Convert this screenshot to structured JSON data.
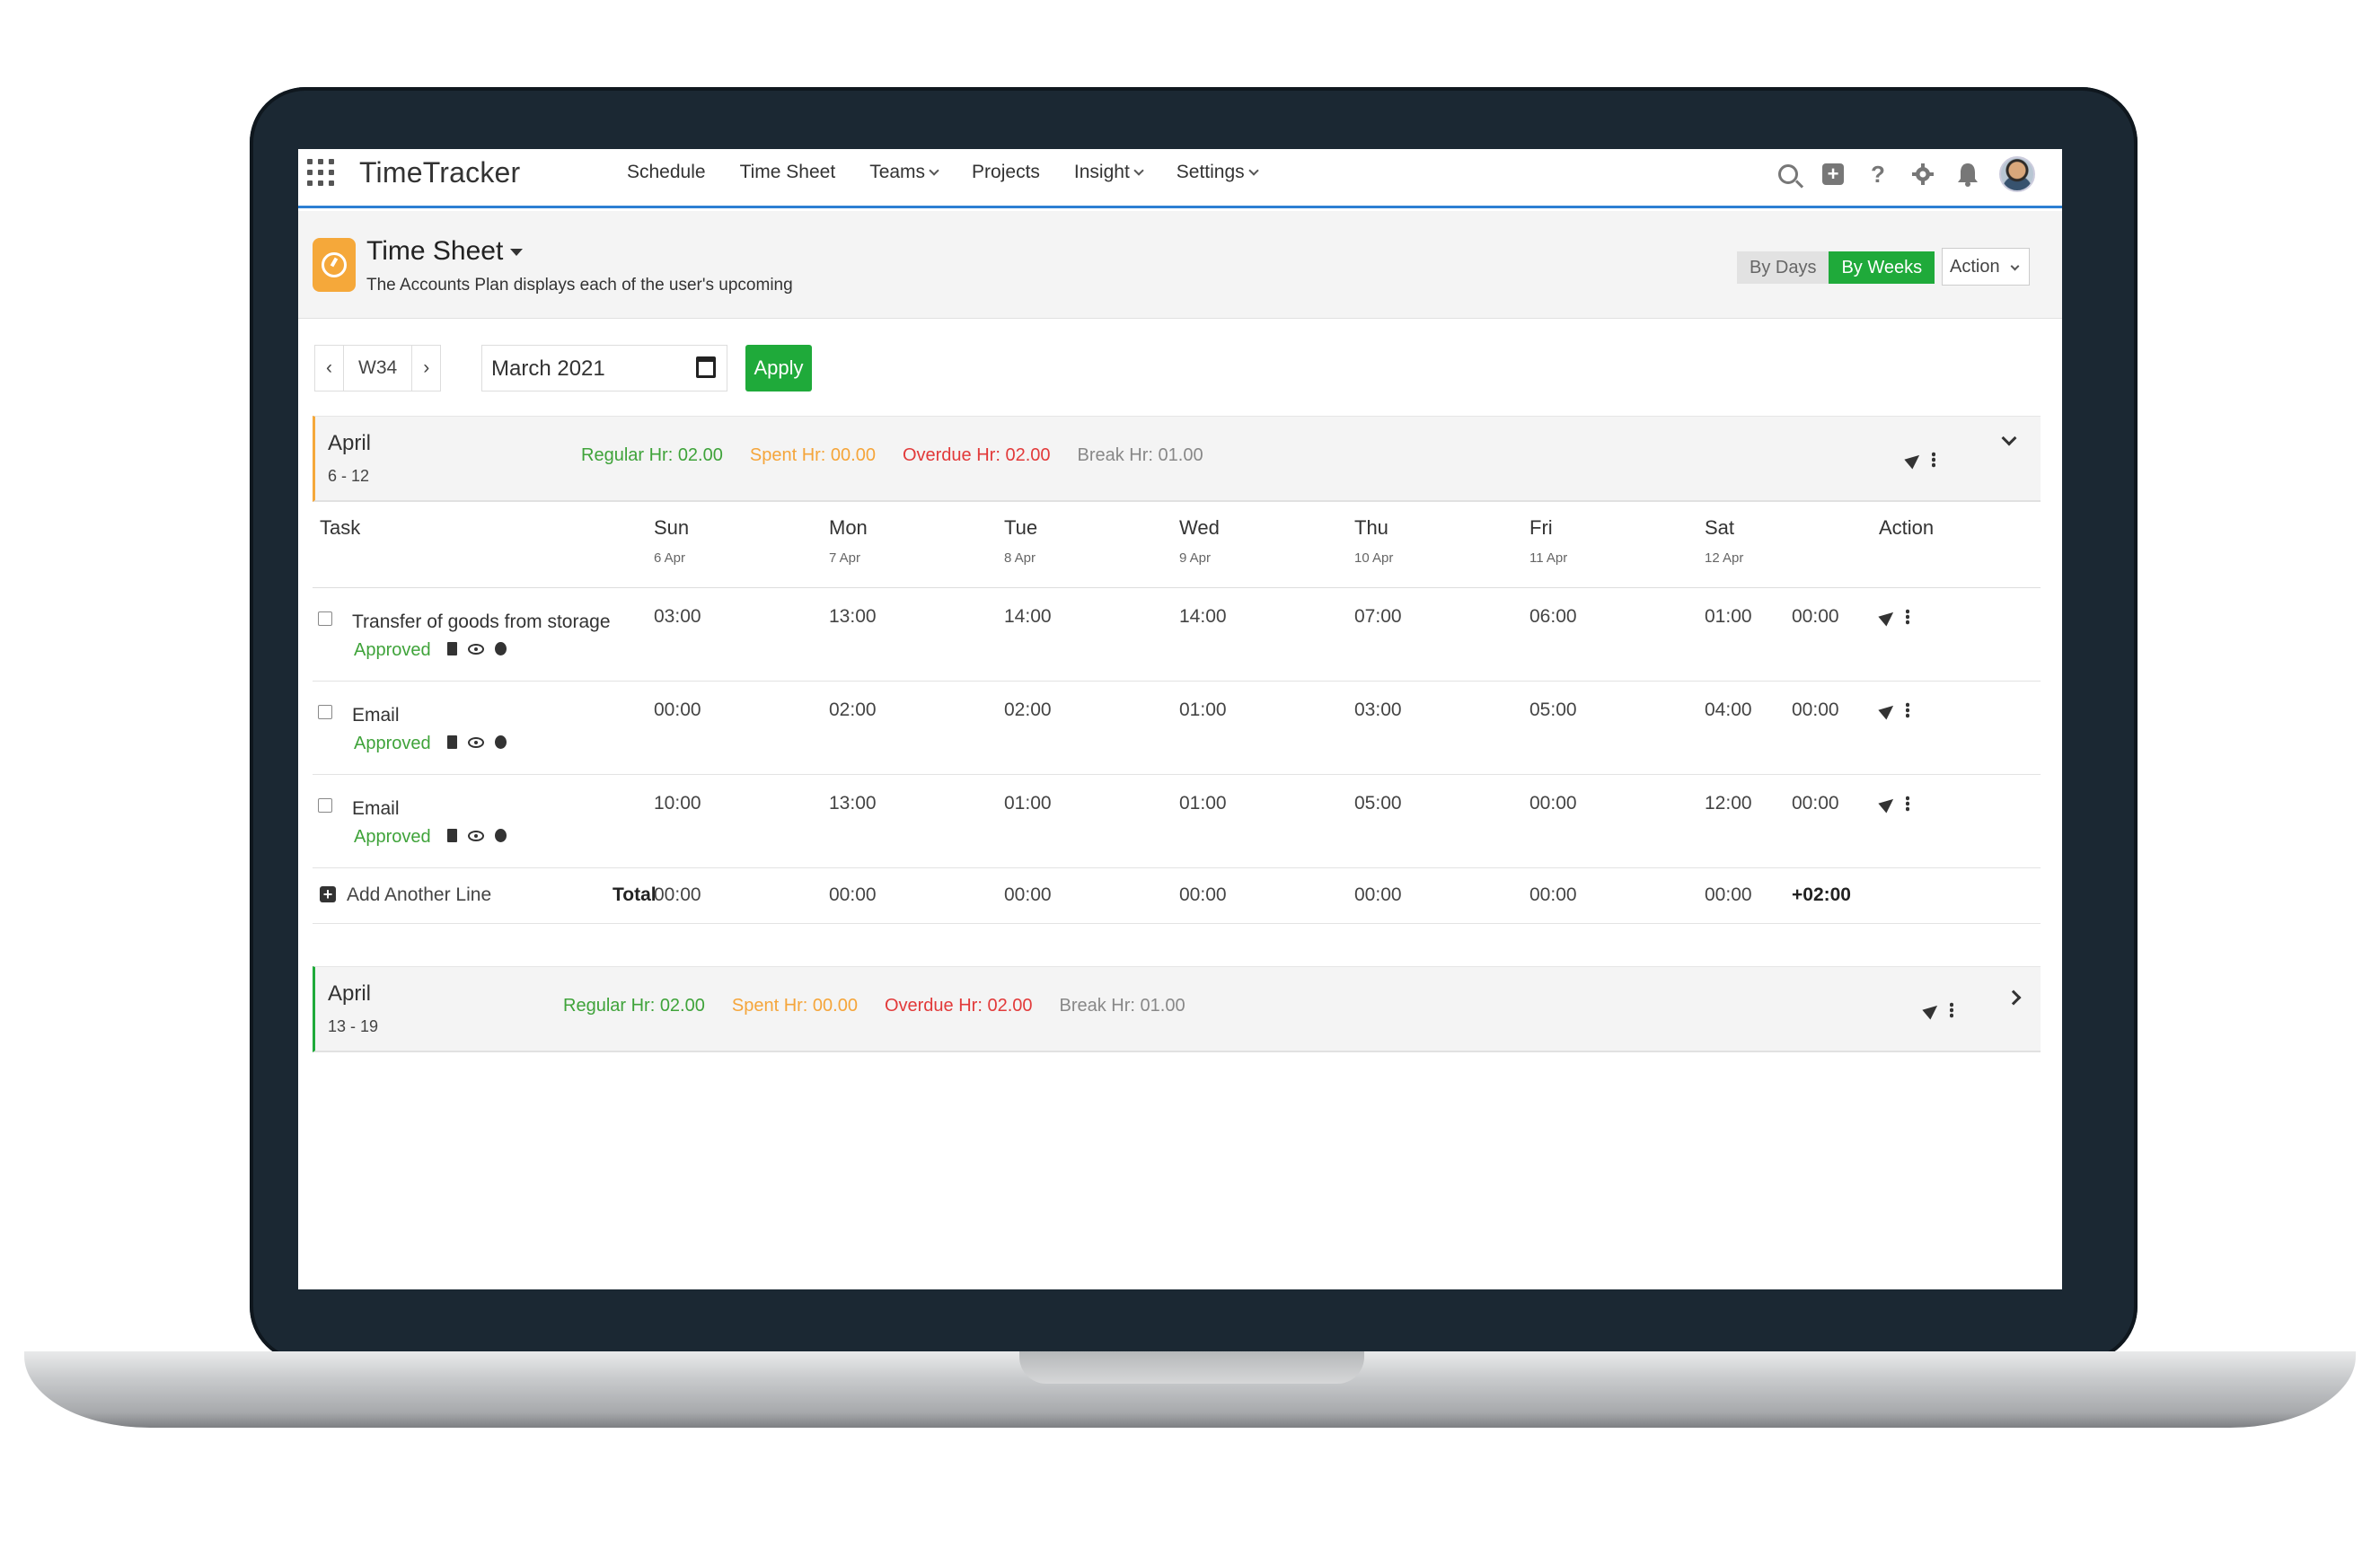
{
  "app": {
    "brand": "TimeTracker",
    "menu": [
      {
        "label": "Schedule",
        "dropdown": false
      },
      {
        "label": "Time Sheet",
        "dropdown": false
      },
      {
        "label": "Teams",
        "dropdown": true
      },
      {
        "label": "Projects",
        "dropdown": false
      },
      {
        "label": "Insight",
        "dropdown": true
      },
      {
        "label": "Settings",
        "dropdown": true
      }
    ],
    "tools": {
      "help": "?"
    }
  },
  "page": {
    "title": "Time Sheet",
    "subtitle": "The Accounts Plan displays each of the user's upcoming",
    "view_toggle": {
      "by_days": "By Days",
      "by_weeks": "By Weeks",
      "selected": "By Weeks"
    },
    "action_label": "Action"
  },
  "controls": {
    "prev": "‹",
    "week": "W34",
    "next": "›",
    "date_value": "March 2021",
    "apply_label": "Apply"
  },
  "weeks": [
    {
      "month": "April",
      "range": "6 - 12",
      "regular": "Regular Hr: 02.00",
      "spent": "Spent Hr: 00.00",
      "overdue": "Overdue Hr: 02.00",
      "break": "Break Hr: 01.00",
      "expanded": true
    },
    {
      "month": "April",
      "range": "13 - 19",
      "regular": "Regular Hr: 02.00",
      "spent": "Spent Hr: 00.00",
      "overdue": "Overdue Hr: 02.00",
      "break": "Break Hr: 01.00",
      "expanded": false
    }
  ],
  "table": {
    "task_header": "Task",
    "action_header": "Action",
    "days": [
      {
        "name": "Sun",
        "date": "6 Apr"
      },
      {
        "name": "Mon",
        "date": "7 Apr"
      },
      {
        "name": "Tue",
        "date": "8 Apr"
      },
      {
        "name": "Wed",
        "date": "9 Apr"
      },
      {
        "name": "Thu",
        "date": "10 Apr"
      },
      {
        "name": "Fri",
        "date": "11 Apr"
      },
      {
        "name": "Sat",
        "date": "12 Apr"
      }
    ],
    "rows": [
      {
        "task": "Transfer of goods from storage",
        "status": "Approved",
        "hours": [
          "03:00",
          "13:00",
          "14:00",
          "14:00",
          "07:00",
          "06:00",
          "01:00"
        ],
        "total": "00:00"
      },
      {
        "task": "Email",
        "status": "Approved",
        "hours": [
          "00:00",
          "02:00",
          "02:00",
          "01:00",
          "03:00",
          "05:00",
          "04:00"
        ],
        "total": "00:00"
      },
      {
        "task": "Email",
        "status": "Approved",
        "hours": [
          "10:00",
          "13:00",
          "01:00",
          "01:00",
          "05:00",
          "00:00",
          "12:00"
        ],
        "total": "00:00"
      }
    ],
    "footer": {
      "add_label": "Add Another Line",
      "total_label": "Total",
      "totals": [
        "00:00",
        "00:00",
        "00:00",
        "00:00",
        "00:00",
        "00:00",
        "00:00"
      ],
      "grand_total": "+02:00"
    }
  }
}
